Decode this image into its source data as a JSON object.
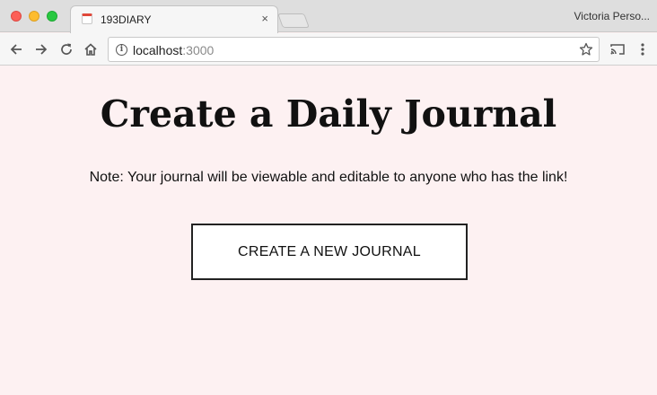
{
  "browser": {
    "tab": {
      "title": "193DIARY",
      "close_glyph": "×",
      "favicon": "calendar-icon"
    },
    "profile_name": "Victoria Perso...",
    "address": {
      "host": "localhost",
      "port": ":3000"
    },
    "icons": {
      "back": "arrow-left-icon",
      "forward": "arrow-right-icon",
      "reload": "reload-icon",
      "home": "home-icon",
      "info": "info-icon",
      "bookmark": "star-icon",
      "cast": "cast-icon",
      "menu": "kebab-menu-icon"
    }
  },
  "page": {
    "heading": "Create a Daily Journal",
    "note": "Note: Your journal will be viewable and editable to anyone who has the link!",
    "create_button_label": "CREATE A NEW JOURNAL"
  },
  "colors": {
    "page_background": "#fdf1f2",
    "button_border": "#222222"
  }
}
